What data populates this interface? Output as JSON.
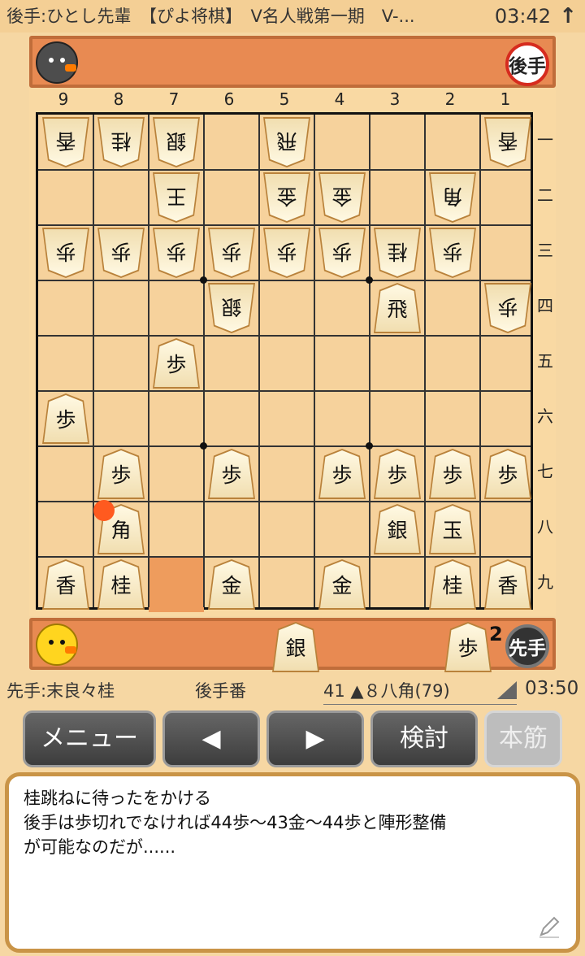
{
  "status": {
    "title": "後手:ひとし先輩　【ぴよ将棋】　V名人戦第一期　V-...",
    "time": "03:42",
    "arrow_icon": "upload-arrow-icon"
  },
  "gote_panel": {
    "badge": "後手",
    "hand": []
  },
  "sente_panel": {
    "badge": "先手",
    "hand": [
      {
        "piece": "銀",
        "count": ""
      },
      {
        "piece": "歩",
        "count": "2"
      }
    ]
  },
  "board": {
    "files": [
      "9",
      "8",
      "7",
      "6",
      "5",
      "4",
      "3",
      "2",
      "1"
    ],
    "ranks": [
      "一",
      "二",
      "三",
      "四",
      "五",
      "六",
      "七",
      "八",
      "九"
    ],
    "pieces": [
      {
        "file": 9,
        "rank": 1,
        "label": "香",
        "owner": "gote"
      },
      {
        "file": 8,
        "rank": 1,
        "label": "桂",
        "owner": "gote"
      },
      {
        "file": 7,
        "rank": 1,
        "label": "銀",
        "owner": "gote"
      },
      {
        "file": 5,
        "rank": 1,
        "label": "飛",
        "owner": "gote"
      },
      {
        "file": 1,
        "rank": 1,
        "label": "香",
        "owner": "gote"
      },
      {
        "file": 7,
        "rank": 2,
        "label": "王",
        "owner": "gote"
      },
      {
        "file": 5,
        "rank": 2,
        "label": "金",
        "owner": "gote"
      },
      {
        "file": 4,
        "rank": 2,
        "label": "金",
        "owner": "gote"
      },
      {
        "file": 2,
        "rank": 2,
        "label": "角",
        "owner": "gote"
      },
      {
        "file": 9,
        "rank": 3,
        "label": "歩",
        "owner": "gote"
      },
      {
        "file": 8,
        "rank": 3,
        "label": "歩",
        "owner": "gote"
      },
      {
        "file": 7,
        "rank": 3,
        "label": "歩",
        "owner": "gote"
      },
      {
        "file": 6,
        "rank": 3,
        "label": "歩",
        "owner": "gote"
      },
      {
        "file": 5,
        "rank": 3,
        "label": "歩",
        "owner": "gote"
      },
      {
        "file": 4,
        "rank": 3,
        "label": "歩",
        "owner": "gote"
      },
      {
        "file": 3,
        "rank": 3,
        "label": "桂",
        "owner": "gote"
      },
      {
        "file": 2,
        "rank": 3,
        "label": "歩",
        "owner": "gote"
      },
      {
        "file": 6,
        "rank": 4,
        "label": "銀",
        "owner": "gote"
      },
      {
        "file": 3,
        "rank": 4,
        "label": "飛",
        "owner": "sente"
      },
      {
        "file": 1,
        "rank": 4,
        "label": "歩",
        "owner": "gote"
      },
      {
        "file": 7,
        "rank": 5,
        "label": "歩",
        "owner": "sente"
      },
      {
        "file": 9,
        "rank": 6,
        "label": "歩",
        "owner": "sente"
      },
      {
        "file": 8,
        "rank": 7,
        "label": "歩",
        "owner": "sente"
      },
      {
        "file": 6,
        "rank": 7,
        "label": "歩",
        "owner": "sente"
      },
      {
        "file": 4,
        "rank": 7,
        "label": "歩",
        "owner": "sente"
      },
      {
        "file": 3,
        "rank": 7,
        "label": "歩",
        "owner": "sente"
      },
      {
        "file": 2,
        "rank": 7,
        "label": "歩",
        "owner": "sente"
      },
      {
        "file": 1,
        "rank": 7,
        "label": "歩",
        "owner": "sente"
      },
      {
        "file": 8,
        "rank": 8,
        "label": "角",
        "owner": "sente"
      },
      {
        "file": 3,
        "rank": 8,
        "label": "銀",
        "owner": "sente"
      },
      {
        "file": 2,
        "rank": 8,
        "label": "玉",
        "owner": "sente"
      },
      {
        "file": 9,
        "rank": 9,
        "label": "香",
        "owner": "sente"
      },
      {
        "file": 8,
        "rank": 9,
        "label": "桂",
        "owner": "sente"
      },
      {
        "file": 6,
        "rank": 9,
        "label": "金",
        "owner": "sente"
      },
      {
        "file": 4,
        "rank": 9,
        "label": "金",
        "owner": "sente"
      },
      {
        "file": 2,
        "rank": 9,
        "label": "桂",
        "owner": "sente"
      },
      {
        "file": 1,
        "rank": 9,
        "label": "香",
        "owner": "sente"
      }
    ],
    "last_move_from": {
      "file": 7,
      "rank": 9
    },
    "marker_square": {
      "file": 8,
      "rank": 8
    }
  },
  "info": {
    "sente_name": "先手:末良々桂",
    "turn": "後手番",
    "move": "41 ▲８八角(79)",
    "time": "03:50"
  },
  "buttons": [
    {
      "label": "メニュー",
      "enabled": true
    },
    {
      "label": "◀",
      "enabled": true
    },
    {
      "label": "▶",
      "enabled": true
    },
    {
      "label": "検討",
      "enabled": true
    },
    {
      "label": "本筋",
      "enabled": false
    }
  ],
  "comment": {
    "lines": [
      "桂跳ねに待ったをかける",
      "後手は歩切れでなければ44歩～43金～44歩と陣形整備",
      "が可能なのだが......"
    ],
    "edit_icon": "pencil-icon"
  },
  "colors": {
    "panel": "#e88a52",
    "board": "#f6d29c",
    "last_move": "#ee9c5d",
    "marker": "#ff5a1f"
  }
}
